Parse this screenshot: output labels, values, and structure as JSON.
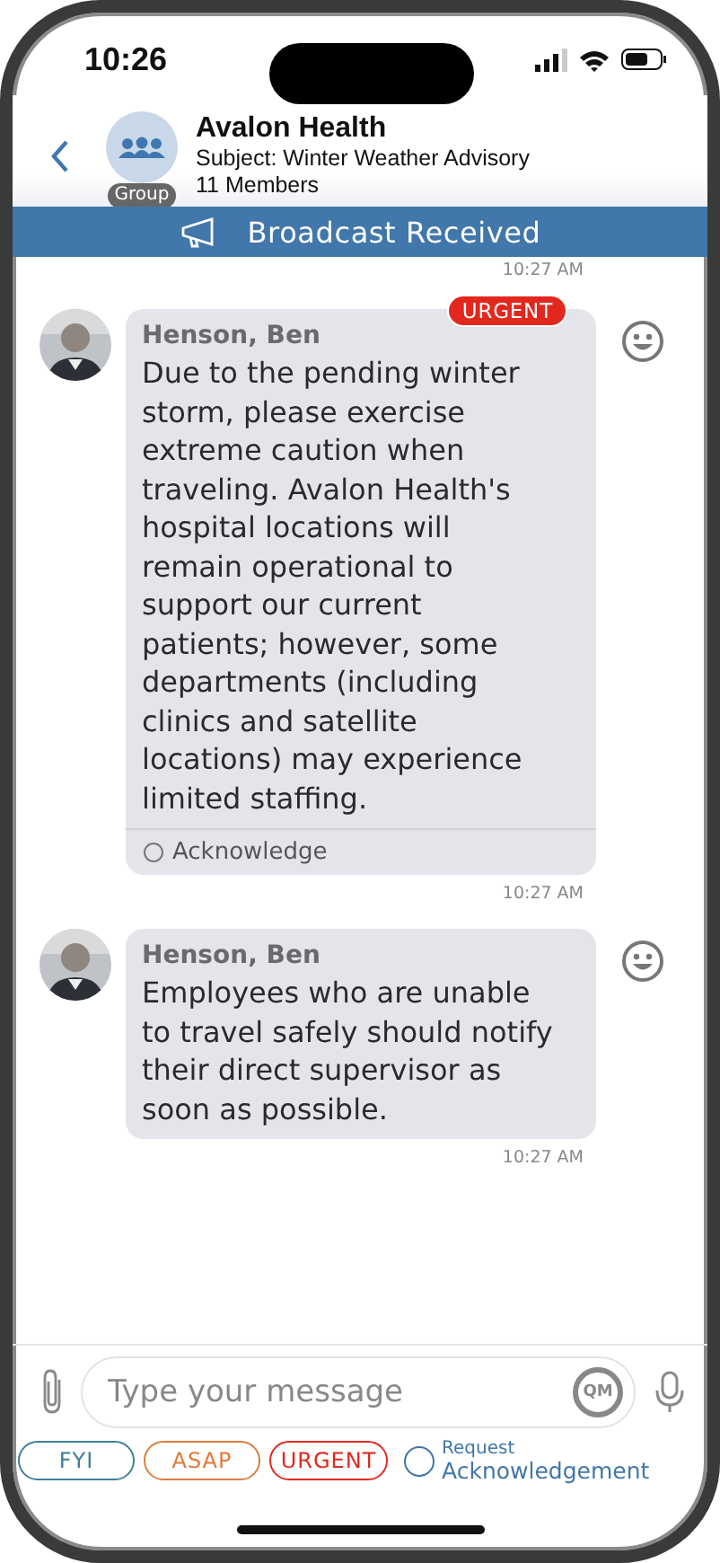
{
  "status_bar": {
    "time": "10:26"
  },
  "header": {
    "title": "Avalon Health",
    "subject": "Subject: Winter Weather Advisory",
    "members": "11 Members",
    "badge": "Group"
  },
  "banner": {
    "text": "Broadcast Received"
  },
  "earlier_time": "10:27 AM",
  "messages": [
    {
      "sender": "Henson, Ben",
      "text": "Due to the pending winter storm, please exercise extreme caution when traveling. Avalon Health's hospital locations will remain operational to support our current patients; however, some departments (including clinics and satellite locations) may experience limited staffing.",
      "priority": "URGENT",
      "acknowledge": {
        "label": "Acknowledge",
        "checked": false
      },
      "time": "10:27 AM"
    },
    {
      "sender": "Henson, Ben",
      "text": "Employees who are unable to travel safely should notify their direct supervisor as soon as possible.",
      "time": "10:27 AM"
    }
  ],
  "composer": {
    "placeholder": "Type your message",
    "quick_button": "QM"
  },
  "priority_options": [
    {
      "label": "FYI",
      "color": "#3f7f98",
      "selected": false
    },
    {
      "label": "ASAP",
      "color": "#e07a3c",
      "selected": false
    },
    {
      "label": "URGENT",
      "color": "#e2281e",
      "selected": false
    }
  ],
  "request_ack": {
    "line1": "Request",
    "line2": "Acknowledgement",
    "checked": false
  }
}
